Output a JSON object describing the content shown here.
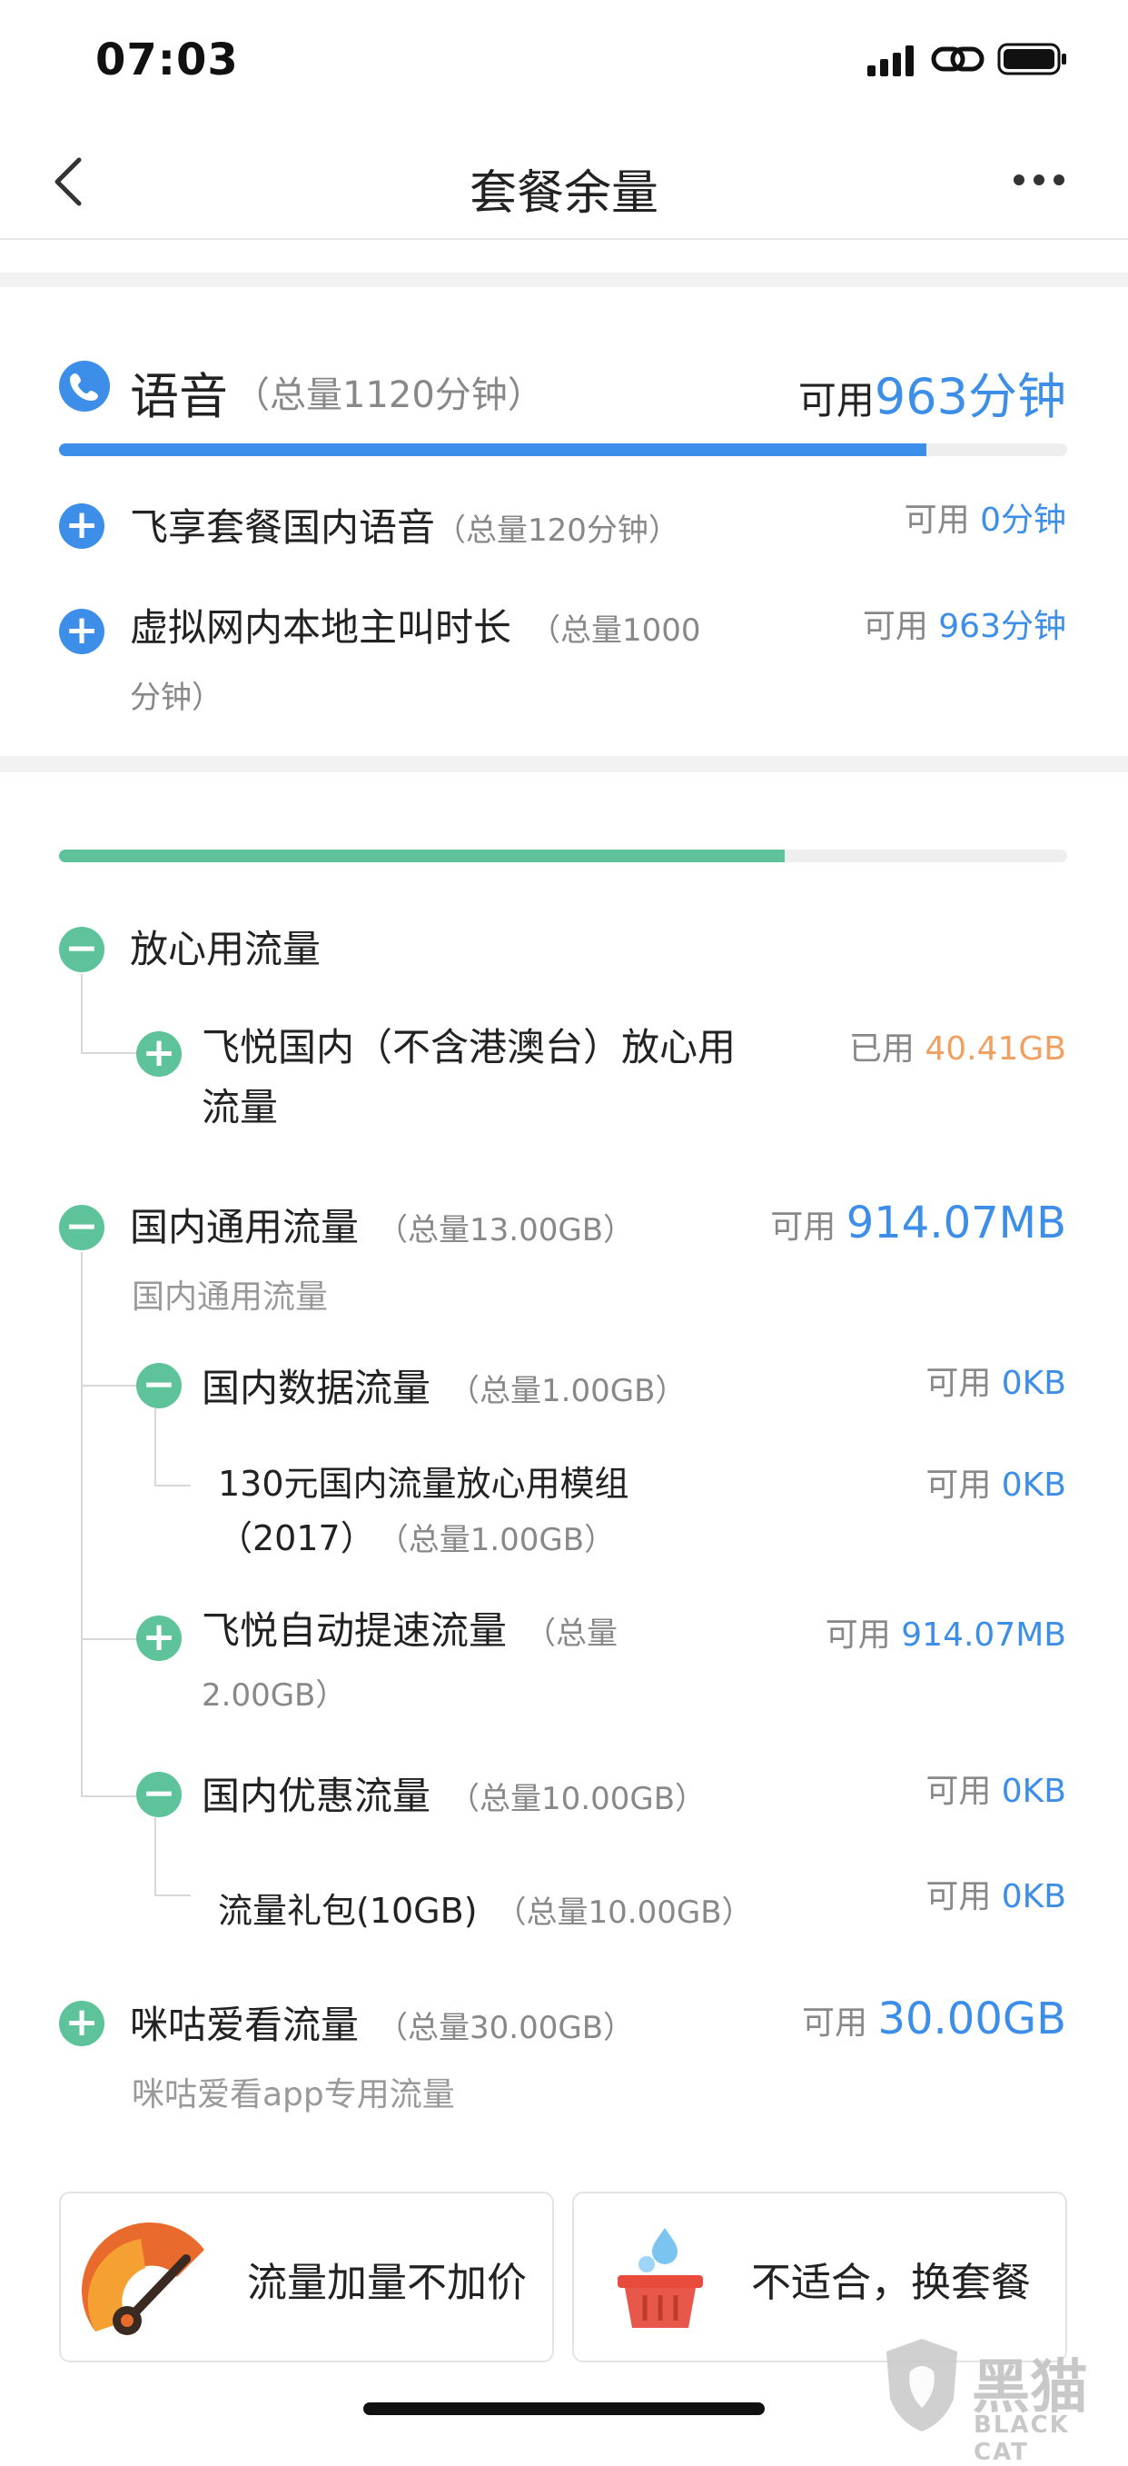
{
  "status_bar": {
    "time": "07:03"
  },
  "nav": {
    "title": "套餐余量"
  },
  "voice": {
    "title": "语音",
    "total": "（总量1120分钟）",
    "avail_label": "可用",
    "avail_value": "963分钟",
    "progress": 0.86,
    "bar_color": "#3d8ee8",
    "items": [
      {
        "name": "飞享套餐国内语音",
        "total": "（总量120分钟）",
        "avail_label": "可用",
        "avail_value": "0分钟"
      },
      {
        "name": "虚拟网内本地主叫时长",
        "total": "（总量1000",
        "total2": "分钟）",
        "avail_label": "可用",
        "avail_value": "963分钟"
      }
    ]
  },
  "data": {
    "progress": 0.72,
    "bar_color": "#5ec39a",
    "worry_free": {
      "title": "放心用流量",
      "child": {
        "name": "飞悦国内（不含港澳台）放心用",
        "name2": "流量",
        "label": "已用",
        "value": "40.41GB"
      }
    },
    "domestic": {
      "title": "国内通用流量",
      "total": "（总量13.00GB）",
      "subtitle": "国内通用流量",
      "avail_label": "可用",
      "avail_value": "914.07MB",
      "children": [
        {
          "name": "国内数据流量",
          "total": "（总量1.00GB）",
          "label": "可用",
          "value": "0KB",
          "sub": {
            "name": "130元国内流量放心用模组",
            "name2": "（2017）",
            "total": "（总量1.00GB）",
            "label": "可用",
            "value": "0KB"
          }
        },
        {
          "name": "飞悦自动提速流量",
          "total": "（总量",
          "total2": "2.00GB）",
          "label": "可用",
          "value": "914.07MB"
        },
        {
          "name": "国内优惠流量",
          "total": "（总量10.00GB）",
          "label": "可用",
          "value": "0KB",
          "sub": {
            "name": "流量礼包(10GB)",
            "total": "（总量10.00GB）",
            "label": "可用",
            "value": "0KB"
          }
        }
      ]
    },
    "migu": {
      "title": "咪咕爱看流量",
      "total": "（总量30.00GB）",
      "subtitle": "咪咕爱看app专用流量",
      "avail_label": "可用",
      "avail_value": "30.00GB"
    }
  },
  "cards": [
    {
      "label": "流量加量不加价",
      "icon": "speedometer-icon"
    },
    {
      "label": "不适合，换套餐",
      "icon": "basket-icon"
    }
  ],
  "watermark": {
    "main": "黑猫",
    "sub": "BLACK CAT"
  }
}
